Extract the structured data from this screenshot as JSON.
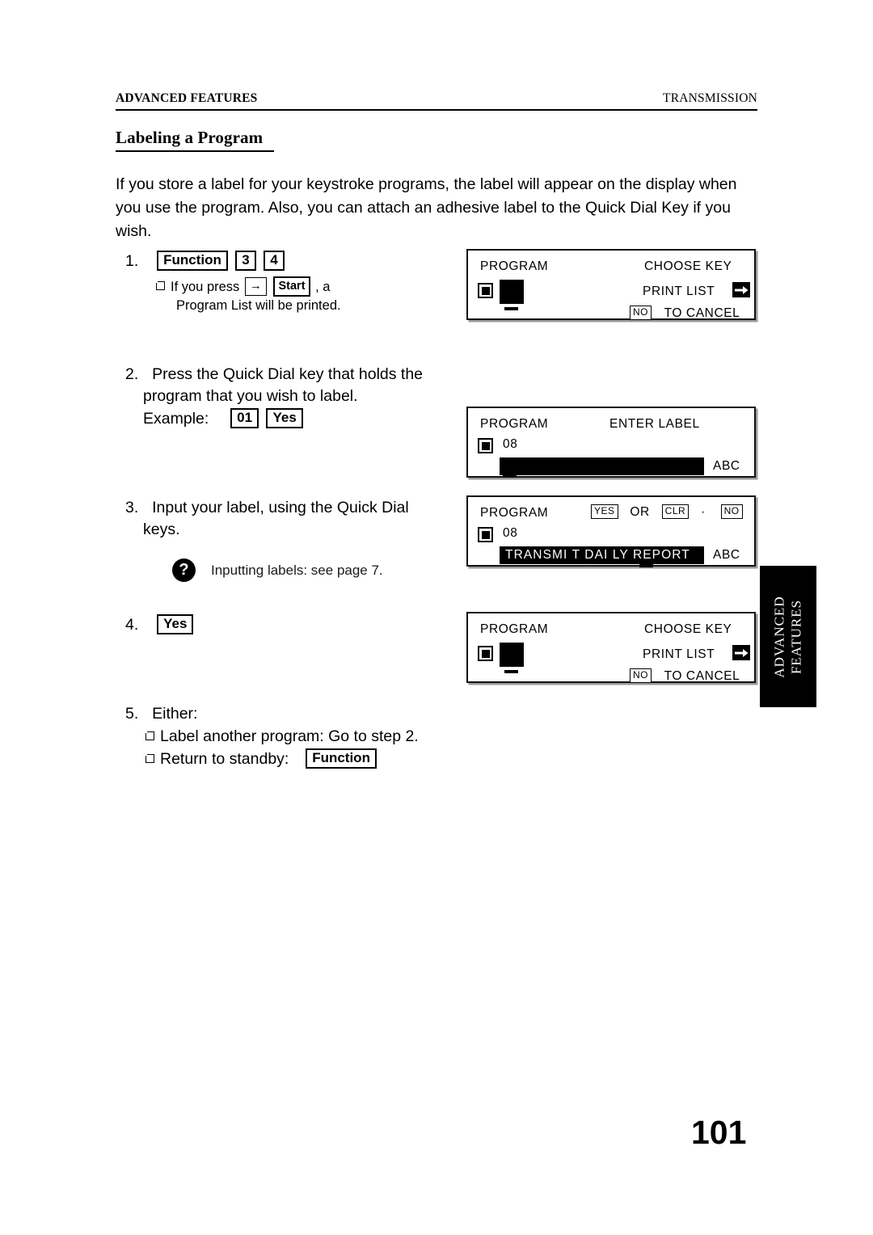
{
  "header": {
    "left": "ADVANCED FEATURES",
    "right": "TRANSMISSION"
  },
  "section": {
    "heading": "Labeling a Program",
    "intro": "If you store a label for your keystroke programs, the label will appear on the display when you use the program. Also, you can attach an adhesive label to the Quick Dial Key if you wish."
  },
  "steps": {
    "one": {
      "number": "1.",
      "keys": [
        "Function",
        "3",
        "4"
      ],
      "note_prefix": "If you press",
      "note_key_arrow": "→",
      "note_key_start": "Start",
      "note_mid": ", a",
      "note_line2": "Program List will be printed."
    },
    "two": {
      "number": "2.",
      "line1": "Press the Quick Dial key that holds the",
      "line2": "program that you wish to label.",
      "example_label": "Example:",
      "example_keys": [
        "01",
        "Yes"
      ]
    },
    "three": {
      "number": "3.",
      "line1": "Input your label, using the Quick Dial",
      "line2": "keys.",
      "note_icon": "?",
      "note_text": "Inputting labels: see page 7."
    },
    "four": {
      "number": "4.",
      "key": "Yes"
    },
    "five": {
      "number": "5.",
      "title": "Either:",
      "option1": "Label another program: Go to step 2.",
      "option2_text": "Return to standby:",
      "option2_key": "Function"
    }
  },
  "lcd_panels": [
    {
      "title": "PROGRAM",
      "top_right": "CHOOSE KEY",
      "mid_right": "PRINT LIST",
      "mid_right_icon": "arrow-right-icon",
      "bottom_key": "NO",
      "bottom_right": "TO CANCEL",
      "cursor": "block"
    },
    {
      "title": "PROGRAM",
      "top_right": "ENTER LABEL",
      "entry_number": "08",
      "field_text": "",
      "mode": "ABC"
    },
    {
      "title": "PROGRAM",
      "key_yes": "YES",
      "or_text": "OR",
      "key_clr": "CLR",
      "dot": "·",
      "key_no": "NO",
      "entry_number": "08",
      "field_text": "TRANSMI T DAI LY REPORT",
      "mode": "ABC"
    },
    {
      "title": "PROGRAM",
      "top_right": "CHOOSE KEY",
      "mid_right": "PRINT LIST",
      "mid_right_icon": "arrow-right-icon",
      "bottom_key": "NO",
      "bottom_right": "TO CANCEL",
      "cursor": "block"
    }
  ],
  "side_tab": {
    "line1": "ADVANCED",
    "line2": "FEATURES"
  },
  "page_number": "101"
}
